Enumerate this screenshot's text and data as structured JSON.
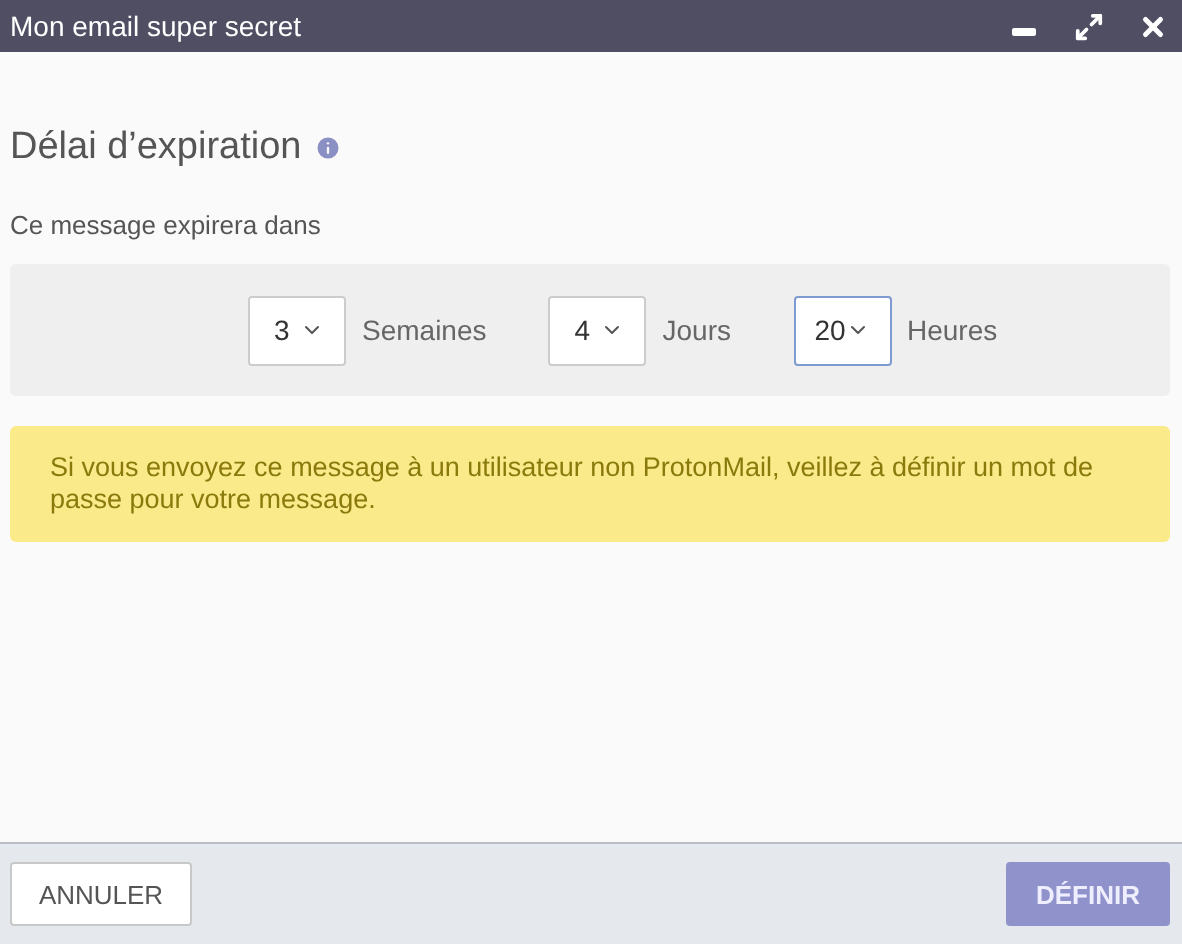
{
  "window": {
    "title": "Mon email super secret"
  },
  "heading": "Délai d’expiration",
  "subtitle": "Ce message expirera dans",
  "selects": [
    {
      "value": "3",
      "unit": "Semaines",
      "focused": false
    },
    {
      "value": "4",
      "unit": "Jours",
      "focused": false
    },
    {
      "value": "20",
      "unit": "Heures",
      "focused": true
    }
  ],
  "warning": "Si vous envoyez ce message à un utilisateur non ProtonMail, veillez à définir un mot de passe pour votre message.",
  "buttons": {
    "cancel": "ANNULER",
    "confirm": "DÉFINIR"
  }
}
